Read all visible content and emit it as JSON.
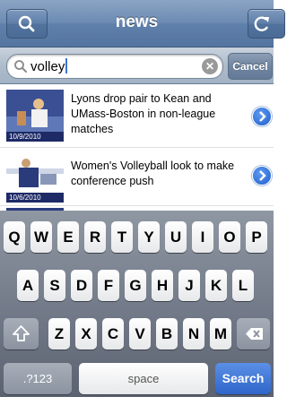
{
  "navbar": {
    "title": "news",
    "left_icon": "search-icon",
    "right_icon": "refresh-icon"
  },
  "search": {
    "query": "volley",
    "cancel_label": "Cancel",
    "search_icon": "magnifier-icon",
    "clear_icon": "clear-icon"
  },
  "results": [
    {
      "title": "Lyons drop pair to Kean and UMass-Boston in non-league matches",
      "date": "10/9/2010"
    },
    {
      "title": "Women's Volleyball look to make conference push",
      "date": "10/6/2010"
    },
    {
      "title": "",
      "date": ""
    }
  ],
  "keyboard": {
    "row1": [
      "Q",
      "W",
      "E",
      "R",
      "T",
      "Y",
      "U",
      "I",
      "O",
      "P"
    ],
    "row2": [
      "A",
      "S",
      "D",
      "F",
      "G",
      "H",
      "J",
      "K",
      "L"
    ],
    "row3": [
      "Z",
      "X",
      "C",
      "V",
      "B",
      "N",
      "M"
    ],
    "shift_icon": "shift-icon",
    "delete_icon": "delete-icon",
    "numbers_label": ".?123",
    "space_label": "space",
    "search_label": "Search"
  },
  "colors": {
    "nav": "#6d8cb3",
    "accent": "#2f66c9"
  }
}
